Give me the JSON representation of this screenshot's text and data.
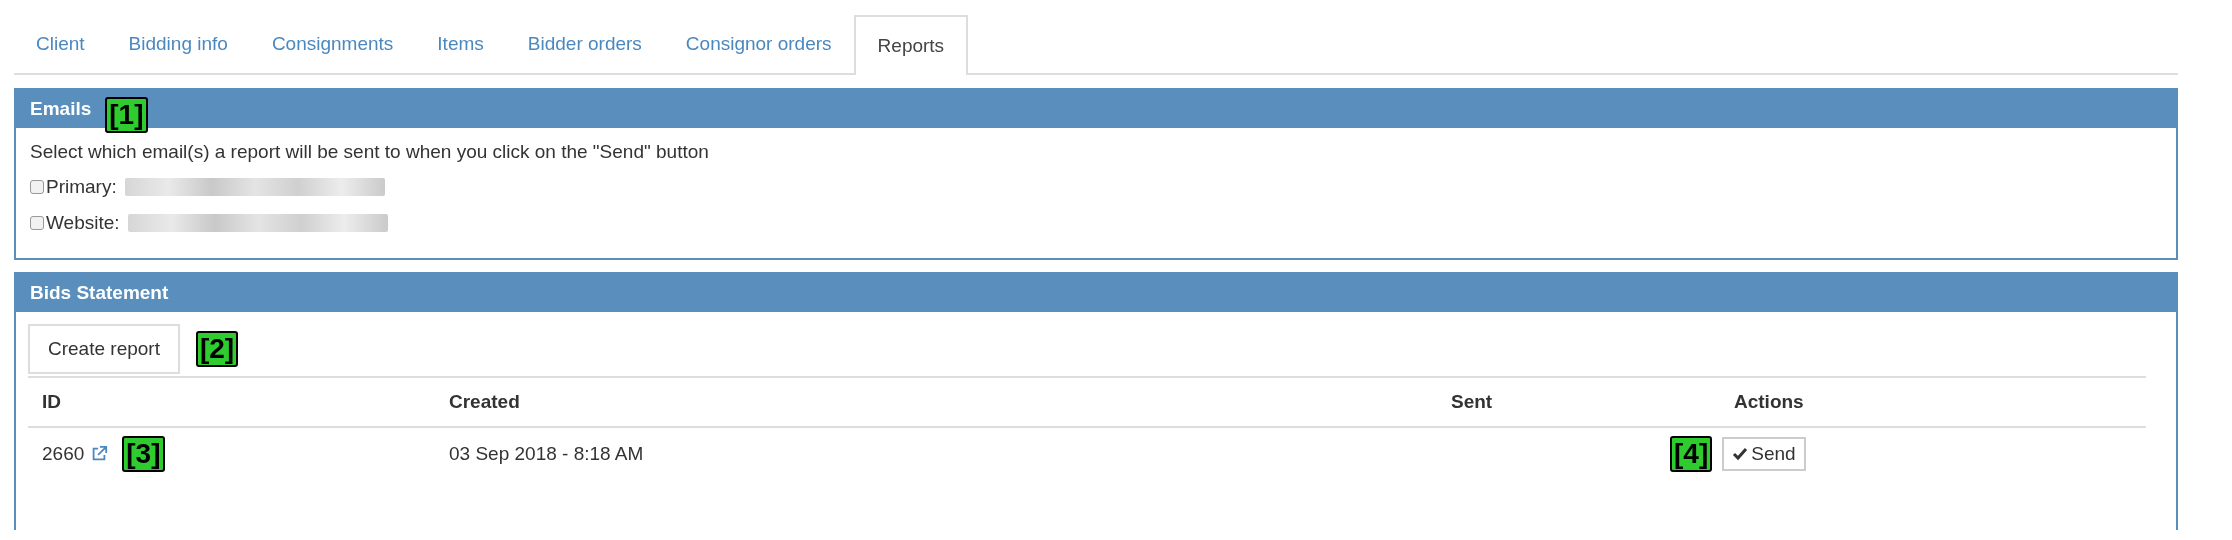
{
  "tabs": [
    {
      "label": "Client",
      "selected": false
    },
    {
      "label": "Bidding info",
      "selected": false
    },
    {
      "label": "Consignments",
      "selected": false
    },
    {
      "label": "Items",
      "selected": false
    },
    {
      "label": "Bidder orders",
      "selected": false
    },
    {
      "label": "Consignor orders",
      "selected": false
    },
    {
      "label": "Reports",
      "selected": true
    }
  ],
  "emails_panel": {
    "title": "Emails",
    "callout": "[1]",
    "instruction": "Select which email(s) a report will be sent to when you click on the \"Send\" button",
    "options": [
      {
        "label": "Primary:",
        "checked": false
      },
      {
        "label": "Website:",
        "checked": false
      }
    ]
  },
  "bids_statement_panel": {
    "title": "Bids Statement",
    "create_button": {
      "label": "Create report",
      "callout": "[2]"
    },
    "table": {
      "columns": [
        "ID",
        "Created",
        "Sent",
        "Actions"
      ],
      "rows": [
        {
          "id": "2660",
          "id_callout": "[3]",
          "created": "03 Sep 2018 - 8:18 AM",
          "action_callout": "[4]",
          "action": "Send"
        }
      ]
    }
  }
}
